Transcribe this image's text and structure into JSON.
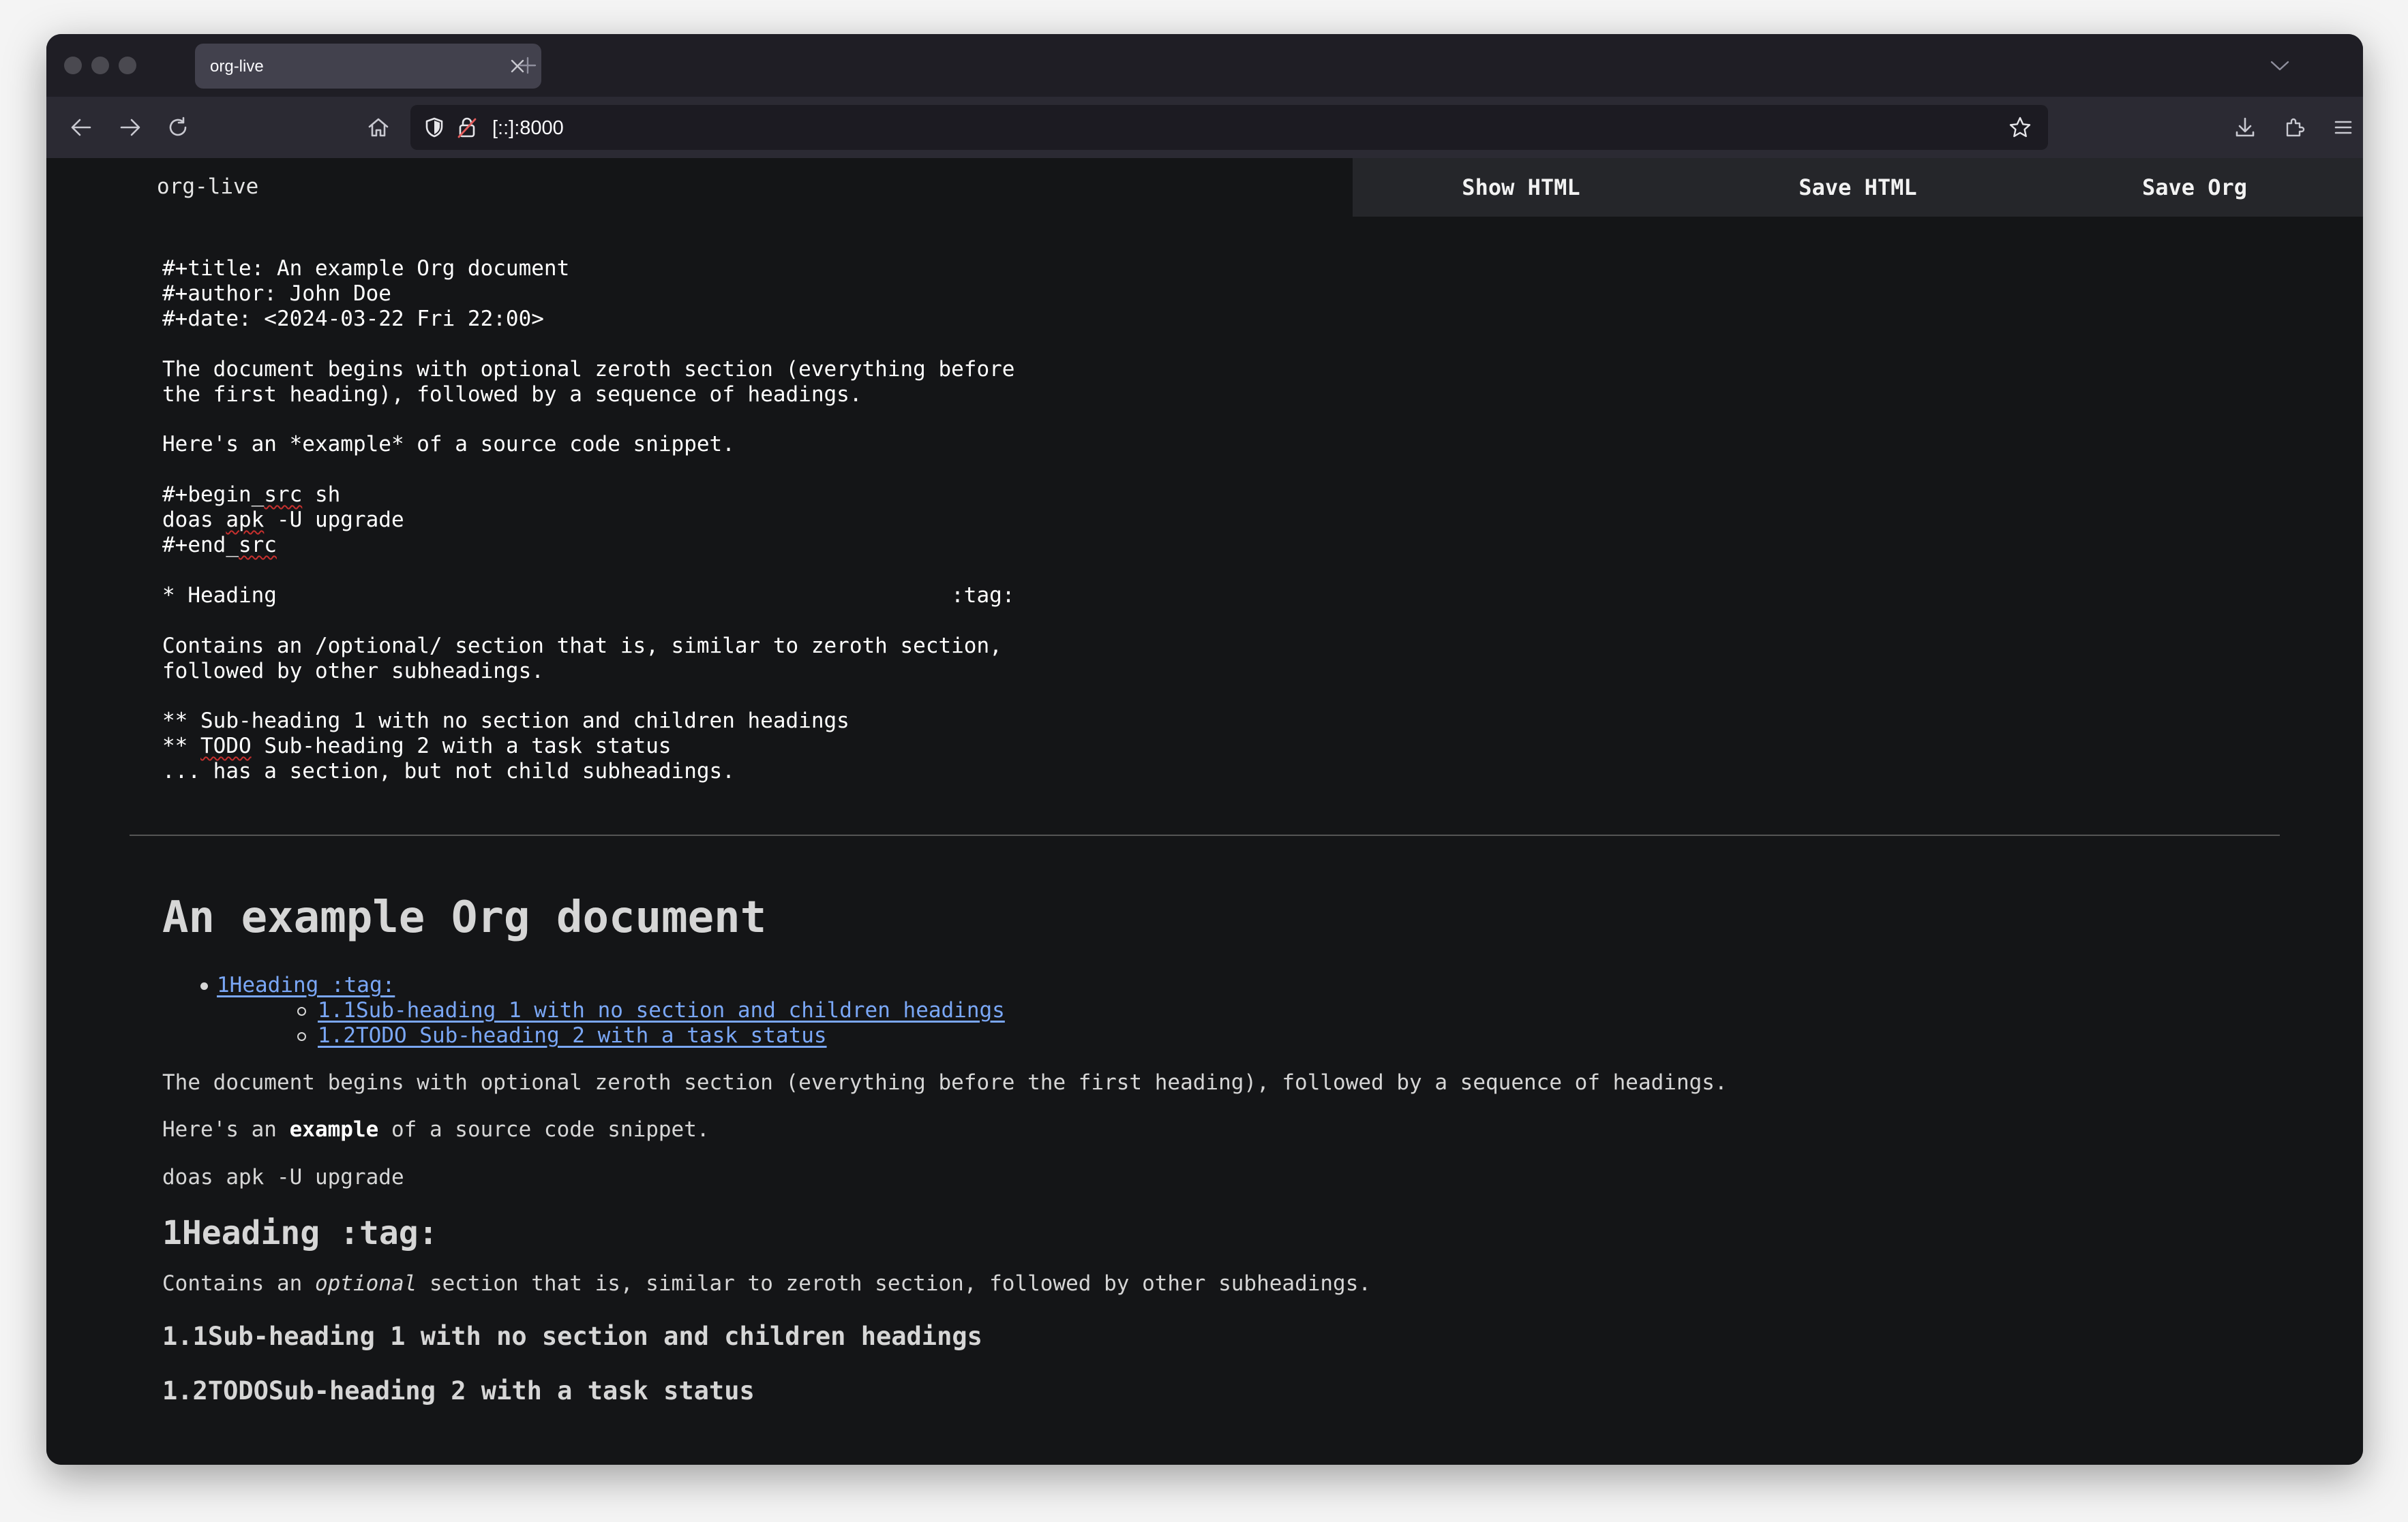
{
  "browser": {
    "tab_title": "org-live",
    "url": "[::]:8000"
  },
  "app": {
    "brand": "org-live",
    "buttons": [
      "Show HTML",
      "Save HTML",
      "Save Org"
    ]
  },
  "source": {
    "lines": {
      "l01": "#+title: An example Org document",
      "l02": "#+author: John Doe",
      "l03": "#+date: <2024-03-22 Fri 22:00>",
      "l05": "The document begins with optional zeroth section (everything before",
      "l06": "the first heading), followed by a sequence of headings.",
      "l08": "Here's an *example* of a source code snippet.",
      "l10a": "#+begin_",
      "l10b": "src",
      "l10c": " sh",
      "l11a": "doas ",
      "l11b": "apk",
      "l11c": " -U upgrade",
      "l12a": "#+end_",
      "l12b": "src",
      "l14": "* Heading                                                     :tag:",
      "l16": "Contains an /optional/ section that is, similar to zeroth section,",
      "l17": "followed by other subheadings.",
      "l19": "** Sub-heading 1 with no section and children headings",
      "l20a": "** ",
      "l20b": "TODO",
      "l20c": " Sub-heading 2 with a task status",
      "l21": "... has a section, but not child subheadings."
    }
  },
  "preview": {
    "title": "An example Org document",
    "toc": {
      "h1": "1Heading :tag:",
      "h1_1": "1.1Sub-heading 1 with no section and children headings",
      "h1_2": "1.2TODO Sub-heading 2 with a task status"
    },
    "para1": "The document begins with optional zeroth section (everything before the first heading), followed by a sequence of headings.",
    "para2": {
      "before": "Here's an ",
      "bold": "example",
      "after": " of a source code snippet."
    },
    "code": "doas apk -U upgrade",
    "heading1": "1Heading :tag:",
    "para3": {
      "before": "Contains an ",
      "italic": "optional",
      "after": " section that is, similar to zeroth section, followed by other subheadings."
    },
    "heading1_1": "1.1Sub-heading 1 with no section and children headings",
    "heading1_2": "1.2TODOSub-heading 2 with a task status"
  },
  "icons": {
    "back": "back-arrow-icon",
    "forward": "forward-arrow-icon",
    "reload": "reload-icon",
    "home": "home-icon",
    "tracking": "shield-icon",
    "security": "lock-icon",
    "bookmark": "star-icon",
    "downloads": "download-icon",
    "extensions": "extensions-icon",
    "menu": "hamburger-menu-icon"
  },
  "colors": {
    "page_bg": "#141517",
    "link": "#7aa7f6",
    "toolbar": "#2b2a33",
    "tabbar": "#1f1e25"
  }
}
